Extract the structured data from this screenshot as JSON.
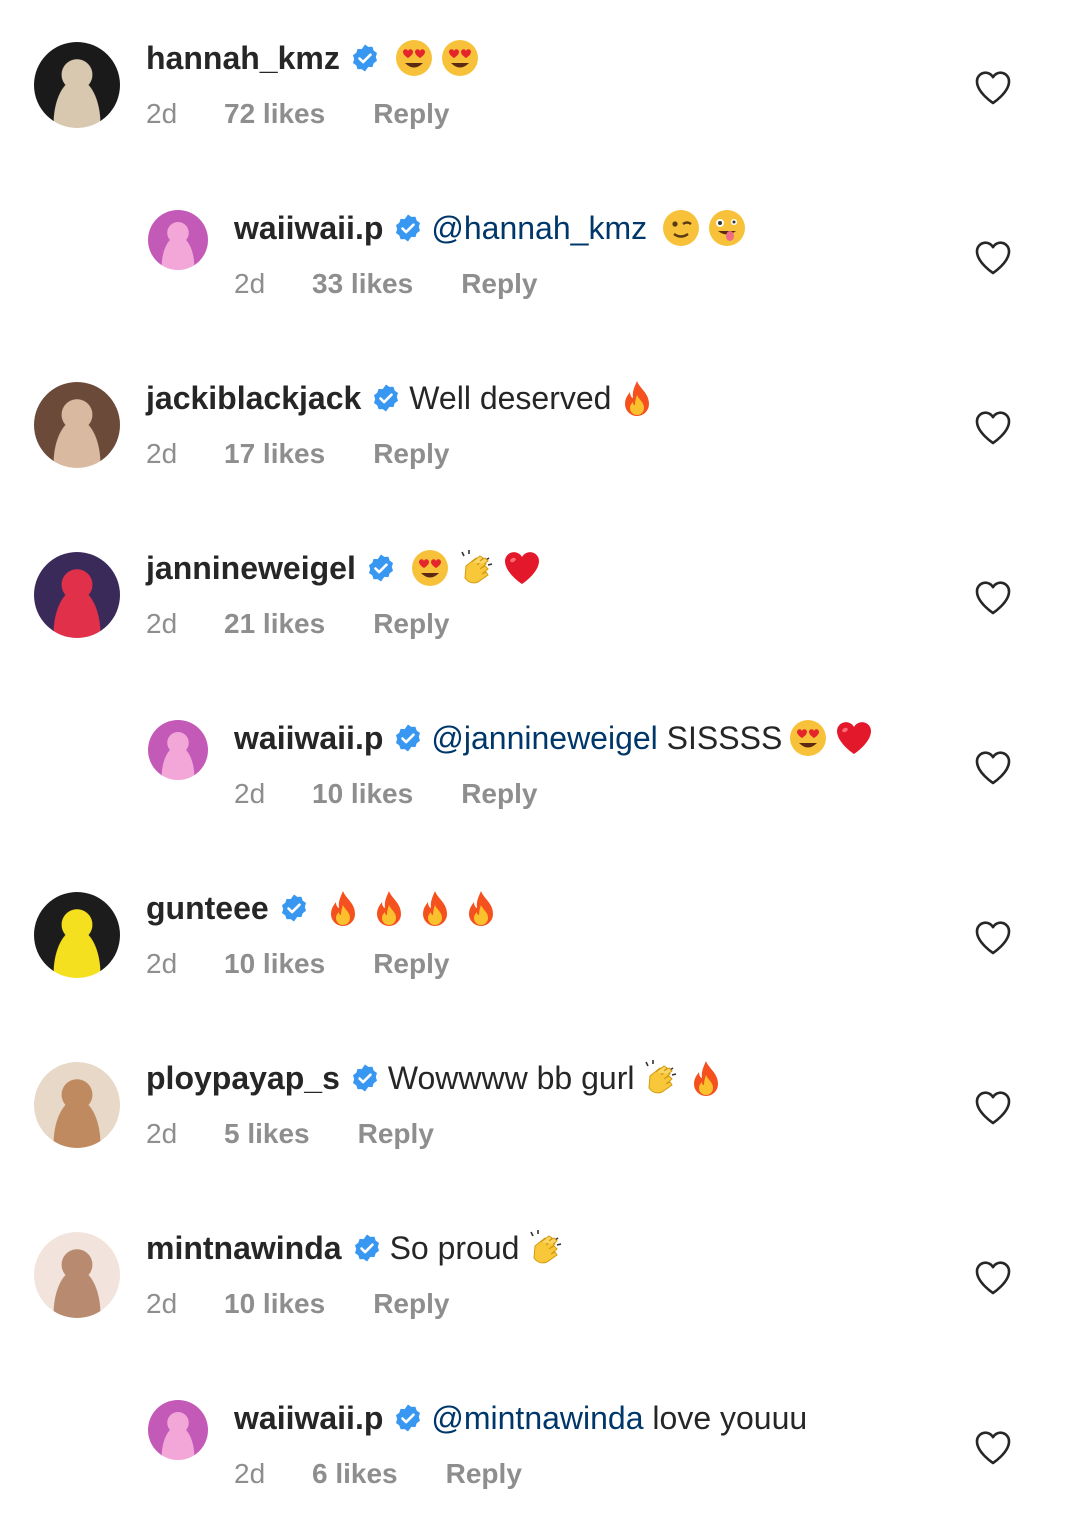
{
  "colors": {
    "username": "#262626",
    "mention": "#00376b",
    "meta": "#8e8e8e",
    "verified": "#3897f0",
    "heart_outline": "#262626"
  },
  "comments": [
    {
      "username": "hannah_kmz",
      "verified": true,
      "is_reply": false,
      "mention": "",
      "text": "",
      "emojis": [
        "heart-eyes",
        "heart-eyes"
      ],
      "time": "2d",
      "likes": "72 likes",
      "reply": "Reply",
      "avatar_colors": [
        "#1a1a1a",
        "#d8c8b0"
      ]
    },
    {
      "username": "waiiwaii.p",
      "verified": true,
      "is_reply": true,
      "mention": "@hannah_kmz",
      "text": "",
      "emojis": [
        "wink",
        "zany"
      ],
      "time": "2d",
      "likes": "33 likes",
      "reply": "Reply",
      "avatar_colors": [
        "#c35ab8",
        "#f2a7d8"
      ]
    },
    {
      "username": "jackiblackjack",
      "verified": true,
      "is_reply": false,
      "mention": "",
      "text": "Well deserved",
      "emojis": [
        "fire"
      ],
      "time": "2d",
      "likes": "17 likes",
      "reply": "Reply",
      "avatar_colors": [
        "#6b4a3a",
        "#d9b9a0"
      ]
    },
    {
      "username": "jannineweigel",
      "verified": true,
      "is_reply": false,
      "mention": "",
      "text": "",
      "emojis": [
        "heart-eyes",
        "clap",
        "red-heart"
      ],
      "time": "2d",
      "likes": "21 likes",
      "reply": "Reply",
      "avatar_colors": [
        "#3a2a5a",
        "#e0304a"
      ]
    },
    {
      "username": "waiiwaii.p",
      "verified": true,
      "is_reply": true,
      "mention": "@jannineweigel",
      "text": "SISSSS",
      "emojis": [
        "heart-eyes",
        "red-heart"
      ],
      "time": "2d",
      "likes": "10 likes",
      "reply": "Reply",
      "avatar_colors": [
        "#c35ab8",
        "#f2a7d8"
      ]
    },
    {
      "username": "gunteee",
      "verified": true,
      "is_reply": false,
      "mention": "",
      "text": "",
      "emojis": [
        "fire",
        "fire",
        "fire",
        "fire"
      ],
      "time": "2d",
      "likes": "10 likes",
      "reply": "Reply",
      "avatar_colors": [
        "#1c1c1c",
        "#f5e020"
      ]
    },
    {
      "username": "ploypayap_s",
      "verified": true,
      "is_reply": false,
      "mention": "",
      "text": "Wowwww bb gurl",
      "emojis": [
        "clap",
        "fire"
      ],
      "time": "2d",
      "likes": "5 likes",
      "reply": "Reply",
      "avatar_colors": [
        "#e8d8c8",
        "#c08a60"
      ]
    },
    {
      "username": "mintnawinda",
      "verified": true,
      "is_reply": false,
      "mention": "",
      "text": "So proud",
      "emojis": [
        "clap"
      ],
      "time": "2d",
      "likes": "10 likes",
      "reply": "Reply",
      "avatar_colors": [
        "#f2e4dc",
        "#b88a70"
      ]
    },
    {
      "username": "waiiwaii.p",
      "verified": true,
      "is_reply": true,
      "mention": "@mintnawinda",
      "text": "love youuu",
      "emojis": [],
      "time": "2d",
      "likes": "6 likes",
      "reply": "Reply",
      "avatar_colors": [
        "#c35ab8",
        "#f2a7d8"
      ]
    }
  ]
}
